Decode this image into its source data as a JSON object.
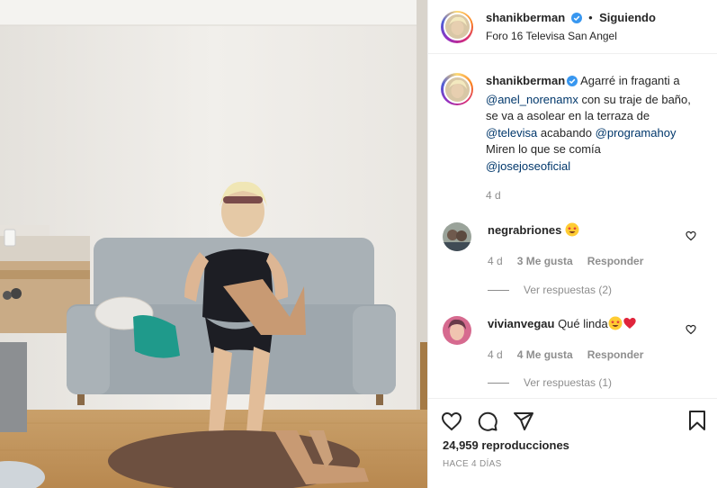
{
  "post": {
    "username": "shanikberman",
    "follow_separator": "•",
    "follow_label": "Siguiendo",
    "location": "Foro 16 Televisa San Angel"
  },
  "caption": {
    "username": "shanikberman",
    "text_1": "Agarré in fraganti a",
    "mention_1": "@anel_norenamx",
    "text_2": "con su traje de baño, se va a asolear en la terraza de",
    "mention_2": "@televisa",
    "text_3": "acabando",
    "mention_3": "@programahoy",
    "text_4": "Miren lo que se comía",
    "mention_4": "@josejoseoficial",
    "time": "4 d"
  },
  "comments": [
    {
      "username": "negrabriones",
      "text": "",
      "emoji": "star-struck",
      "time": "4 d",
      "likes": "3 Me gusta",
      "reply": "Responder",
      "view_replies": "Ver respuestas (2)"
    },
    {
      "username": "vivianvegau",
      "text": "Qué linda",
      "emoji": "star-struck heart",
      "time": "4 d",
      "likes": "4 Me gusta",
      "reply": "Responder",
      "view_replies": "Ver respuestas (1)"
    }
  ],
  "footer": {
    "views": "24,959 reproducciones",
    "posted": "HACE 4 DÍAS"
  },
  "icons": [
    "verified-badge-icon",
    "heart-icon",
    "comment-icon",
    "share-icon",
    "bookmark-icon",
    "star-struck-emoji-icon",
    "red-heart-emoji-icon"
  ],
  "colors": {
    "verified": "#3897f0",
    "mention": "#00376b",
    "muted": "#8e8e8e",
    "heart": "#ed4956"
  }
}
